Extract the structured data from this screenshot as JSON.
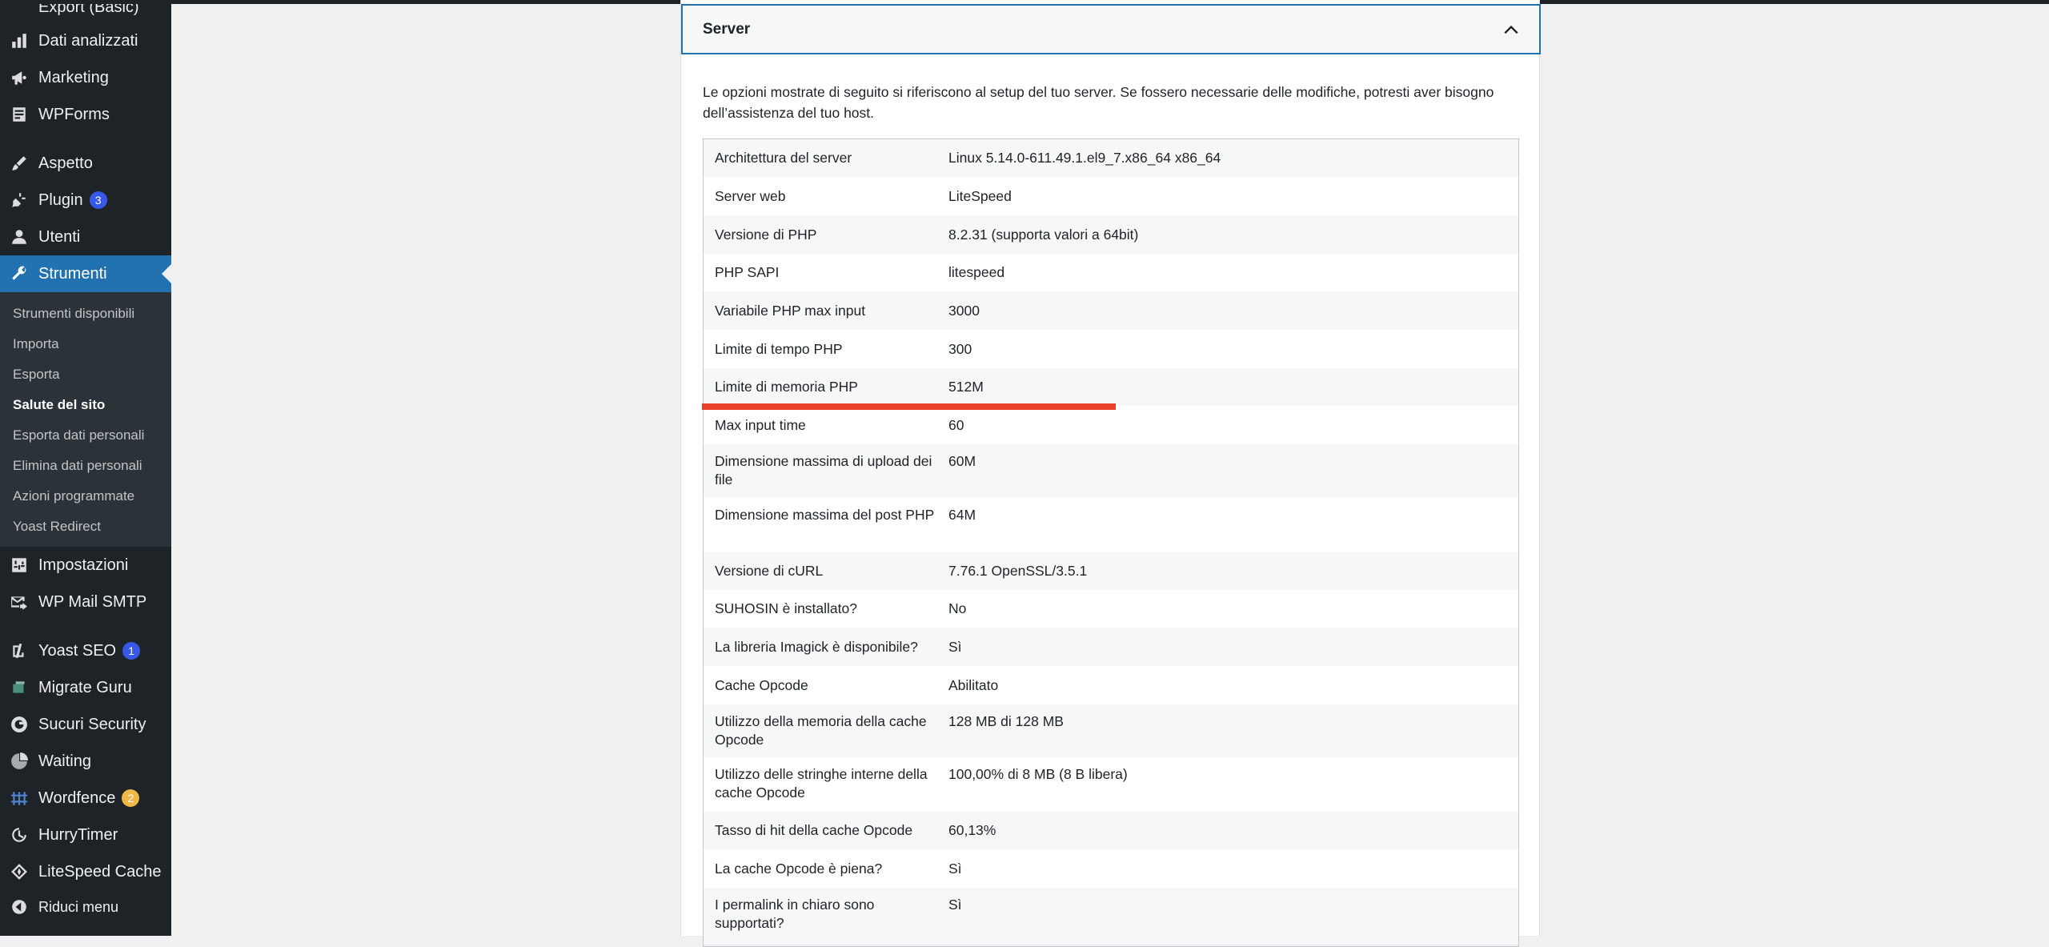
{
  "colors": {
    "sidebar_bg": "#1d2327",
    "active_bg": "#2271b1",
    "badge_blue": "#3858e9",
    "badge_orange": "#f0b849",
    "highlight": "#e8432a"
  },
  "sidebar": {
    "items": [
      {
        "label": "Export (Basic)",
        "icon": "export-icon"
      },
      {
        "label": "Dati analizzati",
        "icon": "bar-chart-icon"
      },
      {
        "label": "Marketing",
        "icon": "megaphone-icon"
      },
      {
        "label": "WPForms",
        "icon": "form-icon"
      },
      {
        "label": "Aspetto",
        "icon": "brush-icon"
      },
      {
        "label": "Plugin",
        "icon": "plugin-icon",
        "badge": "3"
      },
      {
        "label": "Utenti",
        "icon": "user-icon"
      },
      {
        "label": "Strumenti",
        "icon": "wrench-icon"
      },
      {
        "label": "Impostazioni",
        "icon": "settings-icon"
      },
      {
        "label": "WP Mail SMTP",
        "icon": "mail-icon"
      },
      {
        "label": "Yoast SEO",
        "icon": "yoast-icon",
        "badge": "1"
      },
      {
        "label": "Migrate Guru",
        "icon": "migrate-icon"
      },
      {
        "label": "Sucuri Security",
        "icon": "shield-icon"
      },
      {
        "label": "Waiting",
        "icon": "pie-icon"
      },
      {
        "label": "Wordfence",
        "icon": "wordfence-icon",
        "badge": "2"
      },
      {
        "label": "HurryTimer",
        "icon": "timer-icon"
      },
      {
        "label": "LiteSpeed Cache",
        "icon": "diamond-icon"
      },
      {
        "label": "Riduci menu",
        "icon": "collapse-icon"
      }
    ],
    "submenu": [
      "Strumenti disponibili",
      "Importa",
      "Esporta",
      "Salute del sito",
      "Esporta dati personali",
      "Elimina dati personali",
      "Azioni programmate",
      "Yoast Redirect"
    ]
  },
  "panel": {
    "title": "Server",
    "description": "Le opzioni mostrate di seguito si riferiscono al setup del tuo server. Se fossero necessarie delle modifiche, potresti aver bisogno dell’assistenza del tuo host.",
    "rows": [
      {
        "key": "Architettura del server",
        "value": "Linux 5.14.0-611.49.1.el9_7.x86_64 x86_64"
      },
      {
        "key": "Server web",
        "value": "LiteSpeed"
      },
      {
        "key": "Versione di PHP",
        "value": "8.2.31 (supporta valori a 64bit)"
      },
      {
        "key": "PHP SAPI",
        "value": "litespeed"
      },
      {
        "key": "Variabile PHP max input",
        "value": "3000"
      },
      {
        "key": "Limite di tempo PHP",
        "value": "300"
      },
      {
        "key": "Limite di memoria PHP",
        "value": "512M"
      },
      {
        "key": "Max input time",
        "value": "60"
      },
      {
        "key": "Dimensione massima di upload dei file",
        "value": "60M"
      },
      {
        "key": "Dimensione massima del post PHP",
        "value": "64M"
      },
      {
        "key": "Versione di cURL",
        "value": "7.76.1 OpenSSL/3.5.1"
      },
      {
        "key": "SUHOSIN è installato?",
        "value": "No"
      },
      {
        "key": "La libreria Imagick è disponibile?",
        "value": "Sì"
      },
      {
        "key": "Cache Opcode",
        "value": "Abilitato"
      },
      {
        "key": "Utilizzo della memoria della cache Opcode",
        "value": "128 MB di 128 MB"
      },
      {
        "key": "Utilizzo delle stringhe interne della cache Opcode",
        "value": "100,00% di 8 MB (8 B libera)"
      },
      {
        "key": "Tasso di hit della cache Opcode",
        "value": "60,13%"
      },
      {
        "key": "La cache Opcode è piena?",
        "value": "Sì"
      },
      {
        "key": "I permalink in chiaro sono supportati?",
        "value": "Sì"
      }
    ]
  }
}
